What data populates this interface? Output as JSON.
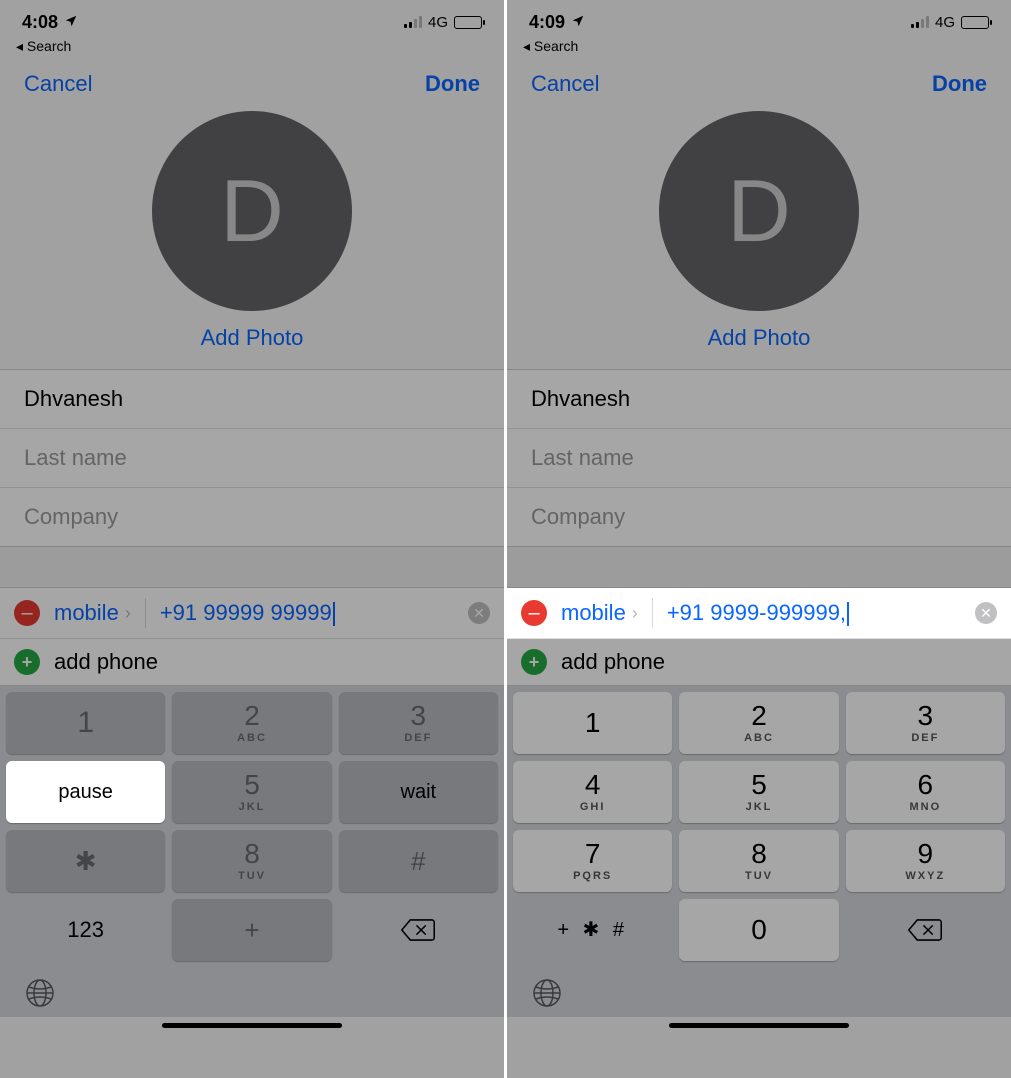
{
  "left": {
    "status": {
      "time": "4:08",
      "net": "4G",
      "back": "◂ Search"
    },
    "nav": {
      "cancel": "Cancel",
      "done": "Done"
    },
    "avatar": {
      "letter": "D",
      "add_photo": "Add Photo"
    },
    "fields": {
      "first": "Dhvanesh",
      "last_placeholder": "Last name",
      "company_placeholder": "Company"
    },
    "phone": {
      "label": "mobile",
      "number": "+91 99999 99999",
      "add_phone": "add phone"
    },
    "keypad": {
      "r1": [
        {
          "digit": "1",
          "letters": ""
        },
        {
          "digit": "2",
          "letters": "ABC"
        },
        {
          "digit": "3",
          "letters": "DEF"
        }
      ],
      "r2_pause": "pause",
      "r2_mid": {
        "digit": "5",
        "letters": "JKL"
      },
      "r2_wait": "wait",
      "r3": [
        {
          "digit": "✱",
          "letters": ""
        },
        {
          "digit": "8",
          "letters": "TUV"
        },
        {
          "digit": "#",
          "letters": ""
        }
      ],
      "r4_left": "123",
      "r4_mid": "+",
      "r4_right": "⌫"
    }
  },
  "right": {
    "status": {
      "time": "4:09",
      "net": "4G",
      "back": "◂ Search"
    },
    "nav": {
      "cancel": "Cancel",
      "done": "Done"
    },
    "avatar": {
      "letter": "D",
      "add_photo": "Add Photo"
    },
    "fields": {
      "first": "Dhvanesh",
      "last_placeholder": "Last name",
      "company_placeholder": "Company"
    },
    "phone": {
      "label": "mobile",
      "number": "+91 9999-999999,",
      "add_phone": "add phone"
    },
    "keypad": {
      "rows": [
        [
          {
            "digit": "1",
            "letters": ""
          },
          {
            "digit": "2",
            "letters": "ABC"
          },
          {
            "digit": "3",
            "letters": "DEF"
          }
        ],
        [
          {
            "digit": "4",
            "letters": "GHI"
          },
          {
            "digit": "5",
            "letters": "JKL"
          },
          {
            "digit": "6",
            "letters": "MNO"
          }
        ],
        [
          {
            "digit": "7",
            "letters": "PQRS"
          },
          {
            "digit": "8",
            "letters": "TUV"
          },
          {
            "digit": "9",
            "letters": "WXYZ"
          }
        ]
      ],
      "r4_left": "+ ✱ #",
      "r4_mid": "0",
      "r4_right": "⌫"
    }
  }
}
